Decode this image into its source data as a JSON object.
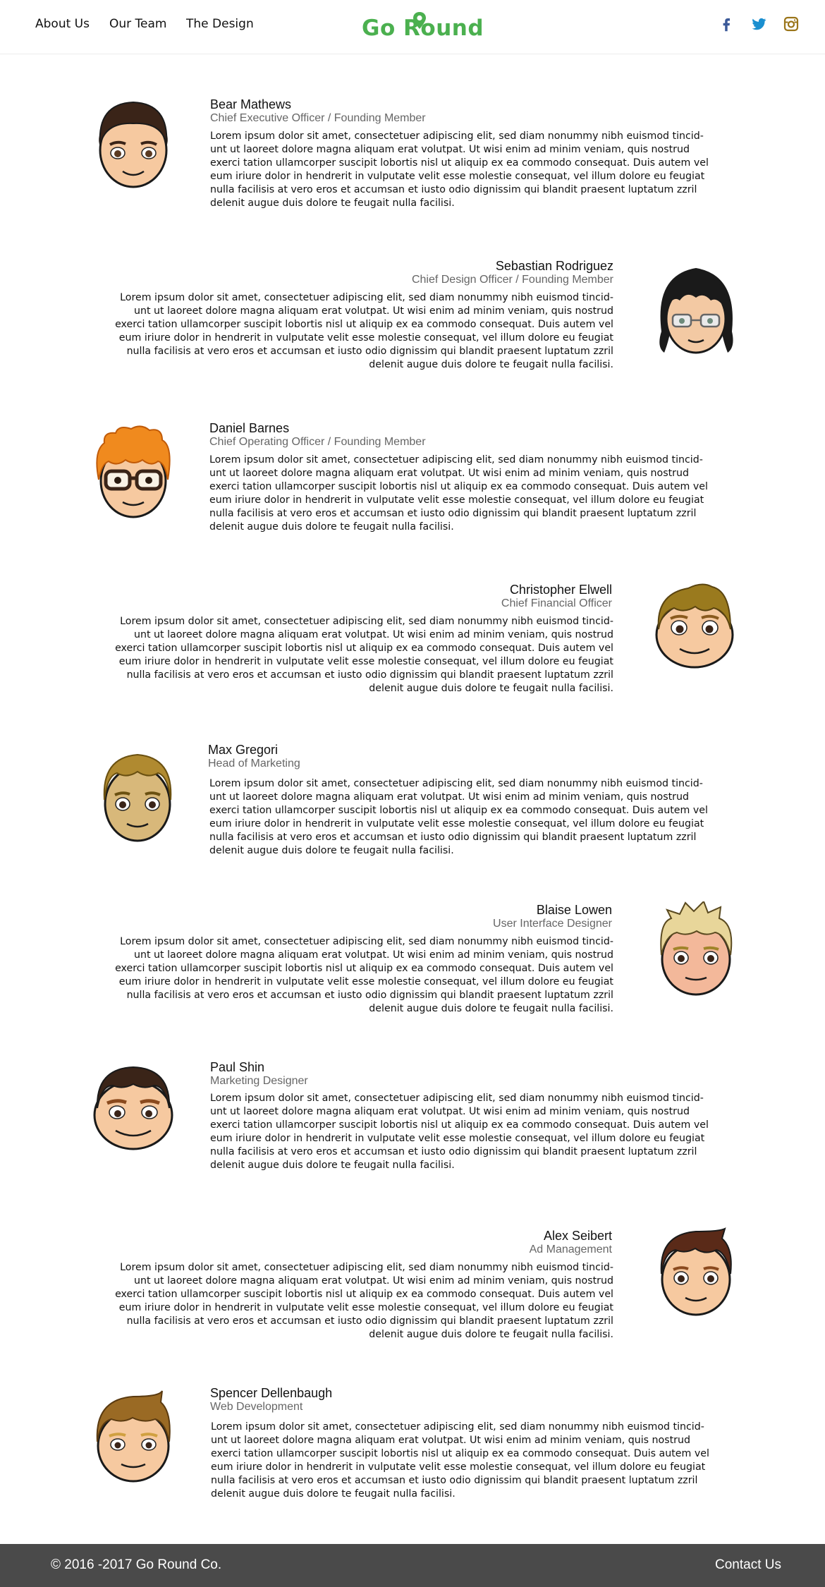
{
  "nav": {
    "links": [
      "About Us",
      "Our Team",
      "The Design"
    ],
    "brand": "Go Round",
    "social": [
      "facebook-icon",
      "twitter-icon",
      "instagram-icon"
    ]
  },
  "members": [
    {
      "name": "Bear Mathews",
      "role": "Chief Executive Officer / Founding Member",
      "bio": "Lorem ipsum dolor sit amet, consectetuer adipiscing elit, sed diam nonummy nibh euismod tincid-unt ut laoreet dolore magna aliquam erat volutpat. Ut wisi enim ad minim veniam, quis nostrud exerci tation ullamcorper suscipit lobortis nisl ut aliquip ex ea commodo consequat. Duis autem vel eum iriure dolor in hendrerit in vulputate velit esse molestie consequat, vel illum dolore eu feugiat nulla facilisis at vero eros et accumsan et iusto odio dignissim qui blandit praesent luptatum zzril delenit augue duis dolore te feugait nulla facilisi."
    },
    {
      "name": "Sebastian Rodriguez",
      "role": "Chief Design Officer / Founding Member",
      "bio": "Lorem ipsum dolor sit amet, consectetuer adipiscing elit, sed diam nonummy nibh euismod tincid-unt ut laoreet dolore magna aliquam erat volutpat. Ut wisi enim ad minim veniam, quis nostrud exerci tation ullamcorper suscipit lobortis nisl ut aliquip ex ea commodo consequat. Duis autem vel eum iriure dolor in hendrerit in vulputate velit esse molestie consequat, vel illum dolore eu feugiat nulla facilisis at vero eros et accumsan et iusto odio dignissim qui blandit praesent luptatum zzril delenit augue duis dolore te feugait nulla facilisi."
    },
    {
      "name": "Daniel Barnes",
      "role": "Chief Operating Officer / Founding Member",
      "bio": "Lorem ipsum dolor sit amet, consectetuer adipiscing elit, sed diam nonummy nibh euismod tincid-unt ut laoreet dolore magna aliquam erat volutpat. Ut wisi enim ad minim veniam, quis nostrud exerci tation ullamcorper suscipit lobortis nisl ut aliquip ex ea commodo consequat. Duis autem vel eum iriure dolor in hendrerit in vulputate velit esse molestie consequat, vel illum dolore eu feugiat nulla facilisis at vero eros et accumsan et iusto odio dignissim qui blandit praesent luptatum zzril delenit augue duis dolore te feugait nulla facilisi."
    },
    {
      "name": "Christopher Elwell",
      "role": "Chief Financial Officer",
      "bio": "Lorem ipsum dolor sit amet, consectetuer adipiscing elit, sed diam nonummy nibh euismod tincid-unt ut laoreet dolore magna aliquam erat volutpat. Ut wisi enim ad minim veniam, quis nostrud exerci tation ullamcorper suscipit lobortis nisl ut aliquip ex ea commodo consequat. Duis autem vel eum iriure dolor in hendrerit in vulputate velit esse molestie consequat, vel illum dolore eu feugiat nulla facilisis at vero eros et accumsan et iusto odio dignissim qui blandit praesent luptatum zzril delenit augue duis dolore te feugait nulla facilisi."
    },
    {
      "name": "Max Gregori",
      "role": "Head of Marketing",
      "bio": "Lorem ipsum dolor sit amet, consectetuer adipiscing elit, sed diam nonummy nibh euismod tincid-unt ut laoreet dolore magna aliquam erat volutpat. Ut wisi enim ad minim veniam, quis nostrud exerci tation ullamcorper suscipit lobortis nisl ut aliquip ex ea commodo consequat. Duis autem vel eum iriure dolor in hendrerit in vulputate velit esse molestie consequat, vel illum dolore eu feugiat nulla facilisis at vero eros et accumsan et iusto odio dignissim qui blandit praesent luptatum zzril delenit augue duis dolore te feugait nulla facilisi."
    },
    {
      "name": "Blaise Lowen",
      "role": "User Interface Designer",
      "bio": "Lorem ipsum dolor sit amet, consectetuer adipiscing elit, sed diam nonummy nibh euismod tincid-unt ut laoreet dolore magna aliquam erat volutpat. Ut wisi enim ad minim veniam, quis nostrud exerci tation ullamcorper suscipit lobortis nisl ut aliquip ex ea commodo consequat. Duis autem vel eum iriure dolor in hendrerit in vulputate velit esse molestie consequat, vel illum dolore eu feugiat nulla facilisis at vero eros et accumsan et iusto odio dignissim qui blandit praesent luptatum zzril delenit augue duis dolore te feugait nulla facilisi."
    },
    {
      "name": "Paul Shin",
      "role": "Marketing Designer",
      "bio": "Lorem ipsum dolor sit amet, consectetuer adipiscing elit, sed diam nonummy nibh euismod tincid-unt ut laoreet dolore magna aliquam erat volutpat. Ut wisi enim ad minim veniam, quis nostrud exerci tation ullamcorper suscipit lobortis nisl ut aliquip ex ea commodo consequat. Duis autem vel eum iriure dolor in hendrerit in vulputate velit esse molestie consequat, vel illum dolore eu feugiat nulla facilisis at vero eros et accumsan et iusto odio dignissim qui blandit praesent luptatum zzril delenit augue duis dolore te feugait nulla facilisi."
    },
    {
      "name": "Alex Seibert",
      "role": "Ad Management",
      "bio": "Lorem ipsum dolor sit amet, consectetuer adipiscing elit, sed diam nonummy nibh euismod tincid-unt ut laoreet dolore magna aliquam erat volutpat. Ut wisi enim ad minim veniam, quis nostrud exerci tation ullamcorper suscipit lobortis nisl ut aliquip ex ea commodo consequat. Duis autem vel eum iriure dolor in hendrerit in vulputate velit esse molestie consequat, vel illum dolore eu feugiat nulla facilisis at vero eros et accumsan et iusto odio dignissim qui blandit praesent luptatum zzril delenit augue duis dolore te feugait nulla facilisi."
    },
    {
      "name": "Spencer Dellenbaugh",
      "role": "Web Development",
      "bio": "Lorem ipsum dolor sit amet, consectetuer adipiscing elit, sed diam nonummy nibh euismod tincid-unt ut laoreet dolore magna aliquam erat volutpat. Ut wisi enim ad minim veniam, quis nostrud exerci tation ullamcorper suscipit lobortis nisl ut aliquip ex ea commodo consequat. Duis autem vel eum iriure dolor in hendrerit in vulputate velit esse molestie consequat, vel illum dolore eu feugiat nulla facilisis at vero eros et accumsan et iusto odio dignissim qui blandit praesent luptatum zzril delenit augue duis dolore te feugait nulla facilisi."
    }
  ],
  "colors": {
    "brand": "#4bb04f",
    "facebook": "#3b5998",
    "twitter": "#1a8fd0",
    "instagram": "#9a7418",
    "footer": "#4a4a4a"
  },
  "footer": {
    "copyright": "© 2016 -2017 Go Round Co.",
    "contact": "Contact Us"
  }
}
